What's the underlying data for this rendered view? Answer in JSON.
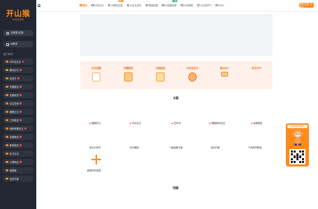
{
  "sidebar": {
    "logo_title": "开山猴",
    "logo_sub": "AI论文写作",
    "login_register": "去登录/注册",
    "ai_assistant": "AI助手",
    "section_title": "热门写作",
    "items": [
      {
        "label": "AI毕业论文",
        "hot": true
      },
      {
        "label": "期刊论文",
        "hot": true
      },
      {
        "label": "任务书",
        "hot": true
      },
      {
        "label": "开题报告",
        "hot": true
      },
      {
        "label": "文献综述",
        "hot": true
      },
      {
        "label": "论文答辩",
        "hot": true
      },
      {
        "label": "课程论文",
        "hot": true
      },
      {
        "label": "工作报告",
        "hot": true
      },
      {
        "label": "调研考察论文",
        "hot": true
      },
      {
        "label": "实践报告",
        "hot": true
      },
      {
        "label": "教学报告",
        "hot": true
      },
      {
        "label": "实习日记",
        "hot": false
      },
      {
        "label": "心得体会",
        "hot": true
      },
      {
        "label": "演讲稿",
        "hot": false
      },
      {
        "label": "活动方案",
        "hot": false
      }
    ]
  },
  "topbar": {
    "tabs": [
      {
        "label": "首页",
        "active": true,
        "badge": ""
      },
      {
        "label": "AI写论文",
        "active": false,
        "badge": ""
      },
      {
        "label": "AI降低文重",
        "active": false,
        "badge": "降低"
      },
      {
        "label": "AI论文改写",
        "active": false,
        "badge": ""
      },
      {
        "label": "降重查重",
        "active": false,
        "badge": ""
      },
      {
        "label": "AI查重检测",
        "active": false,
        "badge": "免费"
      },
      {
        "label": "AI写报告",
        "active": false,
        "badge": ""
      },
      {
        "label": "AI生成PPT",
        "active": false,
        "badge": ""
      },
      {
        "label": "AIGC",
        "active": false,
        "badge": ""
      }
    ],
    "login_button": "登录/注册 立即领"
  },
  "features": [
    {
      "label": "论文选题"
    },
    {
      "label": "开题报告"
    },
    {
      "label": "文献综述"
    },
    {
      "label": "AI毕业论文"
    },
    {
      "label": "降AIGC"
    },
    {
      "label": "论文PPT"
    }
  ],
  "long_section": {
    "title": "长篇",
    "row1": [
      "课程作业",
      "毕业论文",
      "任务书",
      "课程考试论文",
      "实践报告"
    ],
    "row2": [
      "创业计划书",
      "实训报告",
      "一键品牌方案",
      "活动方案",
      "产品研究报告"
    ],
    "add_label": "新建写作类型"
  },
  "short_section": {
    "title": "短篇"
  },
  "float_widget": {
    "title": "扫码关注 领好礼"
  }
}
